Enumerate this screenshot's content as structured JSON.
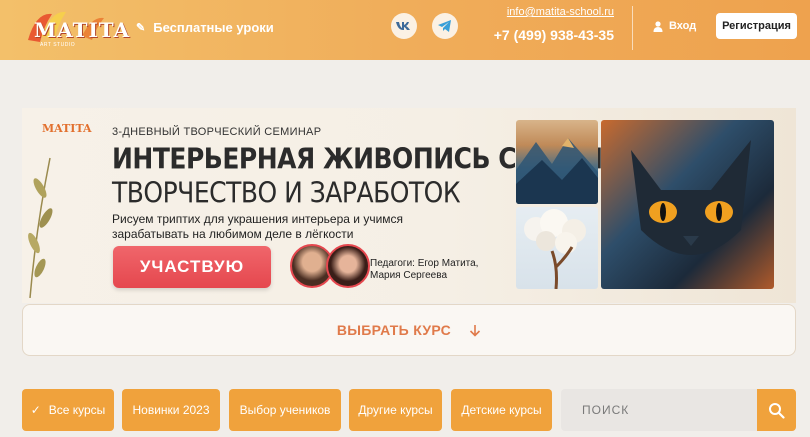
{
  "header": {
    "logo_text": "MATITA",
    "logo_sub": "ART STUDIO",
    "free_lessons": "Бесплатные уроки",
    "email": "info@matita-school.ru",
    "phone": "+7 (499) 938-43-35",
    "login": "Вход",
    "register": "Регистрация",
    "icons": [
      "vk-icon",
      "telegram-icon",
      "user-icon",
      "pencil-icon"
    ]
  },
  "banner": {
    "logo_text": "MATITA",
    "subtitle": "3-ДНЕВНЫЙ ТВОРЧЕСКИЙ СЕМИНАР",
    "title_line1": "ИНТЕРЬЕРНАЯ ЖИВОПИСЬ С НУЛЯ:",
    "title_line2": "ТВОРЧЕСТВО И ЗАРАБОТОК",
    "description": "Рисуем триптих для украшения интерьера и учимся зарабатывать на любимом деле в лёгкости",
    "cta": "УЧАСТВУЮ",
    "teachers_label": "Педагоги: Егор Матита,",
    "teachers_names": "Мария Сергеева"
  },
  "choose_course": "ВЫБРАТЬ КУРС",
  "filters": [
    "Все курсы",
    "Новинки 2023",
    "Выбор учеников",
    "Другие курсы",
    "Детские курсы"
  ],
  "search": {
    "placeholder": "ПОИСК"
  },
  "colors": {
    "header_orange": "#f0ad5a",
    "filter_orange": "#f0a23c",
    "cta_red": "#e5474e",
    "choose_text": "#e07a4a"
  }
}
